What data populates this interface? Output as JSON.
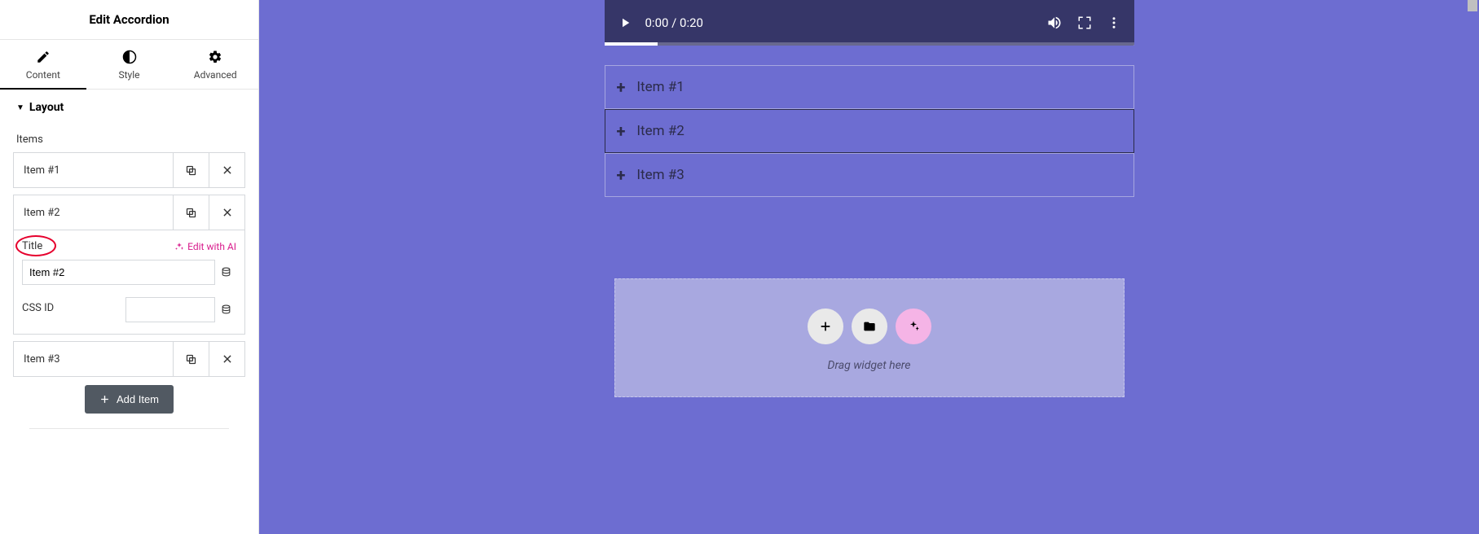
{
  "panel": {
    "title": "Edit Accordion",
    "tabs": {
      "content": "Content",
      "style": "Style",
      "advanced": "Advanced"
    },
    "section_layout": "Layout",
    "items_label": "Items",
    "items": [
      {
        "label": "Item #1"
      },
      {
        "label": "Item #2"
      },
      {
        "label": "Item #3"
      }
    ],
    "expanded": {
      "title_label": "Title",
      "ai_link": "Edit with AI",
      "title_value": "Item #2",
      "cssid_label": "CSS ID",
      "cssid_value": ""
    },
    "add_item": "Add Item"
  },
  "canvas": {
    "video": {
      "time": "0:00 / 0:20"
    },
    "accordion": [
      {
        "label": "Item #1"
      },
      {
        "label": "Item #2"
      },
      {
        "label": "Item #3"
      }
    ],
    "dropzone": "Drag widget here"
  }
}
